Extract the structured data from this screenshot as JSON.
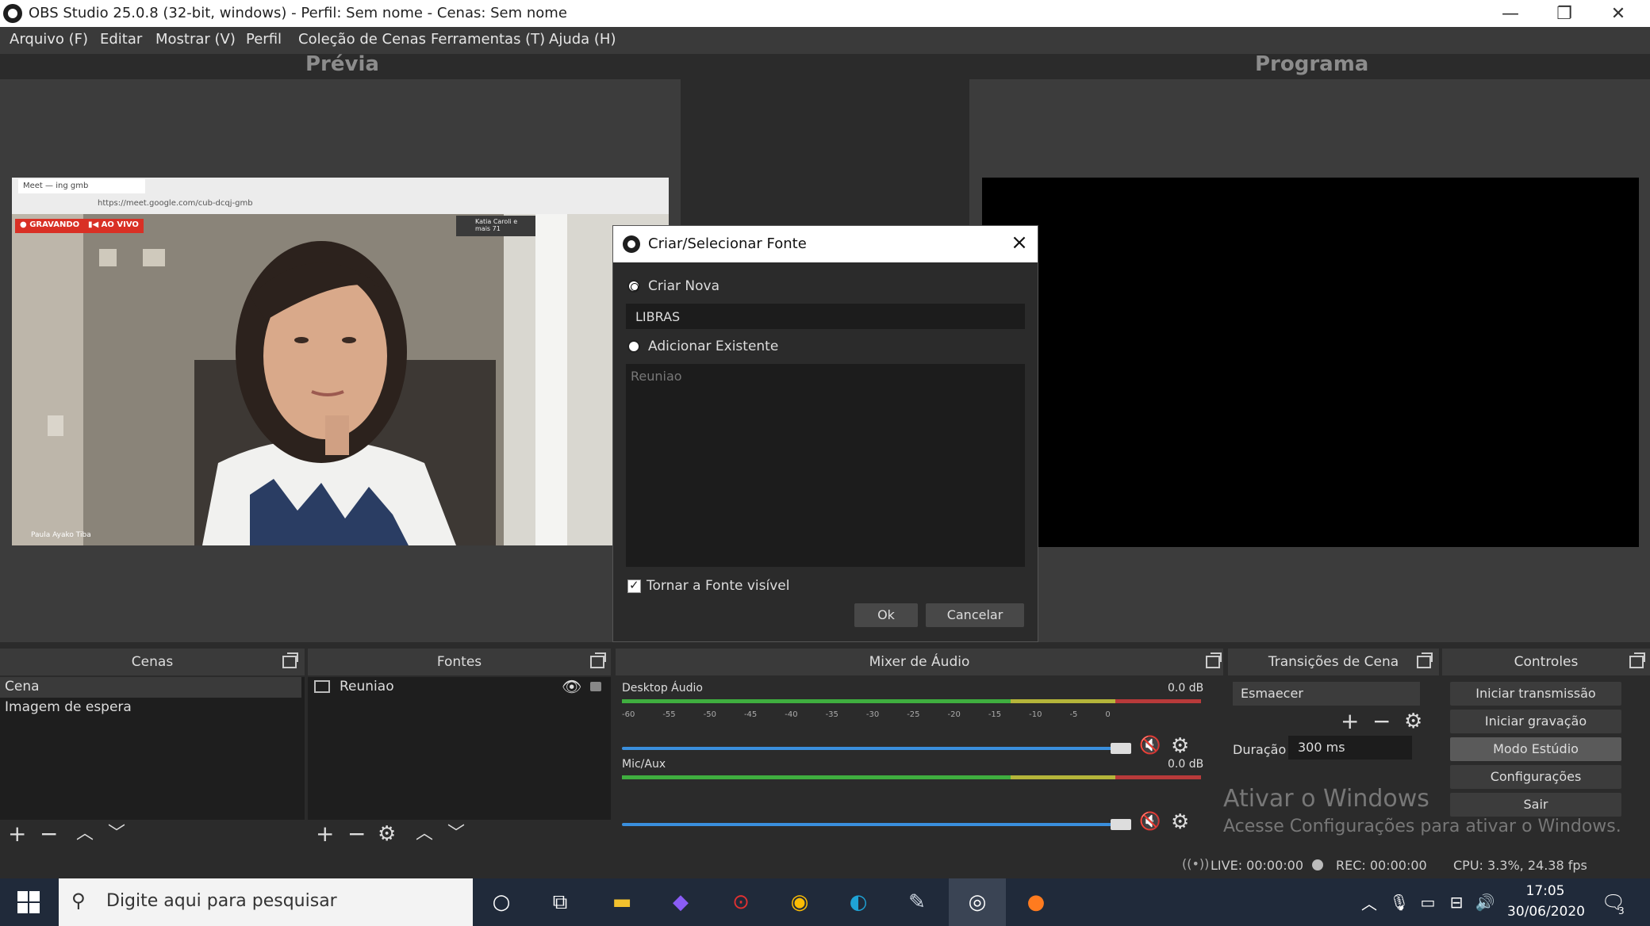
{
  "window": {
    "title": "OBS Studio 25.0.8 (32-bit, windows) - Perfil: Sem nome - Cenas: Sem nome",
    "minimize": "—",
    "restore": "❐",
    "close": "✕"
  },
  "menu": [
    "Arquivo (F)",
    "Editar",
    "Mostrar (V)",
    "Perfil",
    "Coleção de Cenas",
    "Ferramentas (T)",
    "Ajuda (H)"
  ],
  "preview": {
    "title": "Prévia",
    "browser_tab": "Meet — ing gmb",
    "browser_url": "https://meet.google.com/cub-dcqj-gmb",
    "badge_recording": "● GRAVANDO",
    "badge_live": "▮◀ AO VIVO",
    "participant_name": "Paula Ayako Tiba",
    "caller_name": "Katia Caroli e mais 71"
  },
  "program": {
    "title": "Programa"
  },
  "dialog": {
    "title": "Criar/Selecionar Fonte",
    "option_new": "Criar Nova",
    "new_value": "LIBRAS",
    "option_existing": "Adicionar Existente",
    "existing_items": [
      "Reuniao"
    ],
    "visible_label": "Tornar a Fonte visível",
    "ok": "Ok",
    "cancel": "Cancelar"
  },
  "scenes": {
    "title": "Cenas",
    "items": [
      "Cena",
      "Imagem de espera"
    ]
  },
  "sources": {
    "title": "Fontes",
    "items": [
      "Reuniao"
    ]
  },
  "mixer": {
    "title": "Mixer de Áudio",
    "channels": [
      {
        "name": "Desktop Áudio",
        "db": "0.0 dB",
        "level": 0.95
      },
      {
        "name": "Mic/Aux",
        "db": "0.0 dB",
        "level": 0.95
      }
    ],
    "scale": [
      "-60",
      "-55",
      "-50",
      "-45",
      "-40",
      "-35",
      "-30",
      "-25",
      "-20",
      "-15",
      "-10",
      "-5",
      "0"
    ]
  },
  "transitions": {
    "title": "Transições de Cena",
    "selected": "Esmaecer",
    "duration_label": "Duração",
    "duration_value": "300 ms"
  },
  "controls": {
    "title": "Controles",
    "buttons": [
      "Iniciar transmissão",
      "Iniciar gravação",
      "Modo Estúdio",
      "Configurações",
      "Sair"
    ]
  },
  "watermark": {
    "line1": "Ativar o Windows",
    "line2": "Acesse Configurações para ativar o Windows."
  },
  "status": {
    "live": "LIVE: 00:00:00",
    "rec": "REC: 00:00:00",
    "cpu": "CPU: 3.3%, 24.38 fps"
  },
  "taskbar": {
    "search_placeholder": "Digite aqui para pesquisar",
    "time": "17:05",
    "date": "30/06/2020",
    "notifications": "3"
  }
}
